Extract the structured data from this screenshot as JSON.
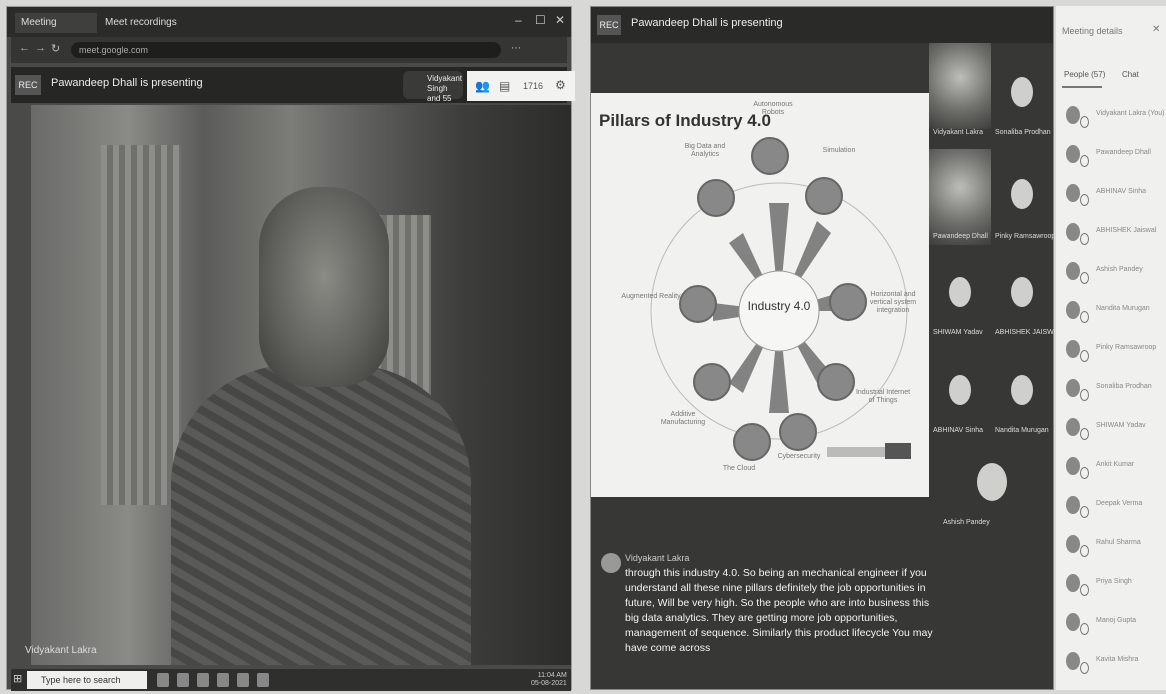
{
  "left_window": {
    "tabs": [
      "Meeting",
      "Meet recordings"
    ],
    "window_controls": [
      "–",
      "☐",
      "✕"
    ],
    "url": "meet.google.com",
    "presenter_banner": "Pawandeep Dhall is presenting",
    "rec_label": "REC",
    "participant_pill": "Vidyakant Singh and 55 more",
    "participant_count": "1716",
    "speaker_name": "Vidyakant Lakra",
    "taskbar_search_placeholder": "Type here to search",
    "clock": {
      "time": "11:04 AM",
      "date": "05-08-2021"
    }
  },
  "right_window": {
    "rec_label": "REC",
    "presenter_banner": "Pawandeep Dhall is presenting",
    "slide": {
      "title": "Pillars of Industry 4.0",
      "hub": "Industry 4.0",
      "pillars": [
        "Autonomous Robots",
        "Simulation",
        "Horizontal and vertical system integration",
        "Industrial Internet of Things",
        "Cybersecurity",
        "The Cloud",
        "Additive Manufacturing",
        "Augmented Reality",
        "Big Data and Analytics"
      ]
    },
    "tiles": [
      {
        "name": "Vidyakant Lakra"
      },
      {
        "name": "Sonaliba Prodhan"
      },
      {
        "name": "Pawandeep Dhall"
      },
      {
        "name": "Pinky Ramsawroop"
      },
      {
        "name": "SHIWAM Yadav"
      },
      {
        "name": "ABHISHEK JAISWAL"
      },
      {
        "name": "ABHINAV Sinha"
      },
      {
        "name": "Nandita Murugan"
      },
      {
        "name": "Ashish Pandey"
      }
    ],
    "caption": {
      "speaker": "Vidyakant Lakra",
      "text": "through this industry 4.0. So being an mechanical engineer if you understand all these nine pillars definitely the job opportunities in future, Will be very high. So the people who are into business this big data analytics. They are getting more job opportunities, management of sequence. Similarly this product lifecycle You may have come across"
    }
  },
  "details_panel": {
    "title": "Meeting details",
    "close": "✕",
    "tab_people": "People (57)",
    "tab_chat": "Chat",
    "participants": [
      "Vidyakant Lakra (You)",
      "Pawandeep Dhall",
      "ABHINAV Sinha",
      "ABHISHEK Jaiswal",
      "Ashish Pandey",
      "Nandita Murugan",
      "Pinky Ramsawroop",
      "Sonaliba Prodhan",
      "SHIWAM Yadav",
      "Ankit Kumar",
      "Deepak Verma",
      "Rahul Sharma",
      "Priya Singh",
      "Manoj Gupta",
      "Kavita Mishra"
    ]
  }
}
